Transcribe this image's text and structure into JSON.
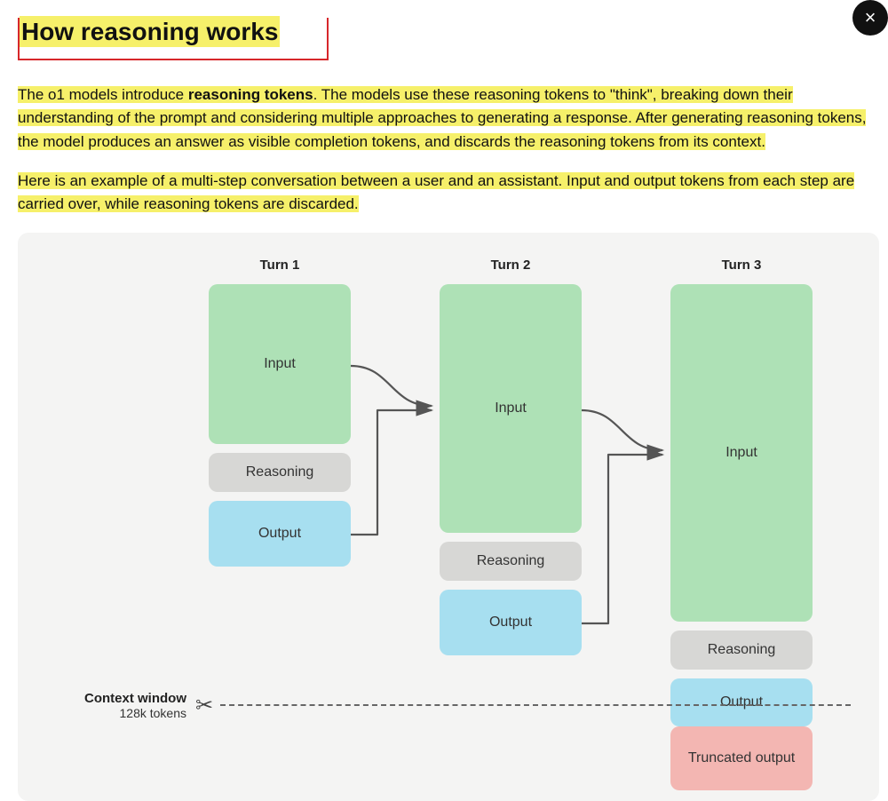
{
  "heading": "How reasoning works",
  "para1": {
    "pre": "The o1 models introduce ",
    "bold": "reasoning tokens",
    "post": ". The models use these reasoning tokens to \"think\", breaking down their understanding of the prompt and considering multiple approaches to generating a response. After generating reasoning tokens, the model produces an answer as visible completion tokens, and discards the reasoning tokens from its context."
  },
  "para2": "Here is an example of a multi-step conversation between a user and an assistant. Input and output tokens from each step are carried over, while reasoning tokens are discarded.",
  "diagram": {
    "turns": [
      "Turn 1",
      "Turn 2",
      "Turn 3"
    ],
    "blocks": {
      "input": "Input",
      "reasoning": "Reasoning",
      "output": "Output",
      "truncated": "Truncated output"
    },
    "context": {
      "label": "Context window",
      "size": "128k tokens"
    }
  },
  "close_label": "×"
}
